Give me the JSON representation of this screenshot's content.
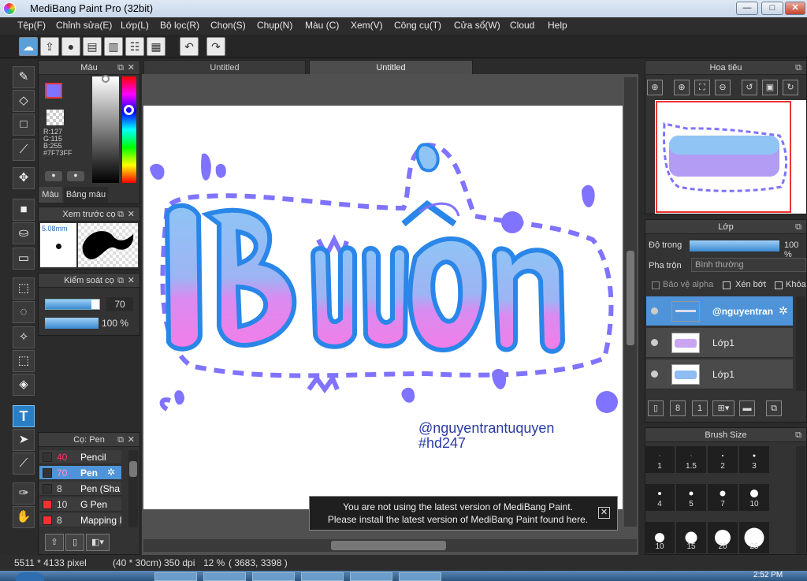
{
  "window": {
    "title": "MediBang Paint Pro (32bit)",
    "min": "—",
    "max": "□",
    "close": "✕"
  },
  "menu": [
    "Tệp(F)",
    "Chỉnh sửa(E)",
    "Lớp(L)",
    "Bộ lọc(R)",
    "Chọn(S)",
    "Chụp(N)",
    "Màu (C)",
    "Xem(V)",
    "Công cụ(T)",
    "Cửa sổ(W)",
    "Cloud",
    "Help"
  ],
  "toolbar": {
    "undo": "↶",
    "redo": "↷"
  },
  "tabs": [
    "Untitled",
    "Untitled"
  ],
  "color_panel": {
    "title": "Màu",
    "r": "R:127",
    "g": "G:115",
    "b": "B:255",
    "hex": "#7F73FF",
    "tab_color": "Màu",
    "tab_palette": "Bảng màu",
    "primary": "#7f73ff",
    "secondary": "#1a1aa0"
  },
  "preview_panel": {
    "title": "Xem trước cọ",
    "size": "5.08mm"
  },
  "control_panel": {
    "title": "Kiểm soát cọ",
    "size": "70",
    "opacity": "100 %"
  },
  "brush_panel": {
    "title": "Cọ: Pen",
    "items": [
      {
        "size": "40",
        "name": "Pencil",
        "color": "#333333"
      },
      {
        "size": "70",
        "name": "Pen",
        "color": "#333333"
      },
      {
        "size": "8",
        "name": "Pen (Sha",
        "color": "#333333"
      },
      {
        "size": "10",
        "name": "G Pen",
        "color": "#e33333"
      },
      {
        "size": "8",
        "name": "Mapping I",
        "color": "#e33333"
      }
    ]
  },
  "canvas": {
    "artwork_text": "Buồn",
    "handle": "@nguyentrantuquyen",
    "hashtag": "#hd247"
  },
  "notice": {
    "line1": "You are not using the latest version of MediBang Paint.",
    "line2": "Please install the latest version of MediBang Paint found here.",
    "close": "✕"
  },
  "status": {
    "size": "5511 * 4133 pixel",
    "dims": "(40 * 30cm)",
    "dpi": "350 dpi",
    "zoom": "12 %",
    "coords": "( 3683, 3398 )"
  },
  "navigator": {
    "title": "Hoa tiêu"
  },
  "layer_panel": {
    "title": "Lớp",
    "opacity_label": "Độ trong",
    "opacity_value": "100 %",
    "blend_label": "Pha trộn",
    "blend_value": "Bình thường",
    "protect_alpha": "Bảo vệ alpha",
    "clipping": "Xén bớt",
    "lock": "Khóa",
    "layers": [
      "@nguyentran",
      "Lớp1",
      "Lớp1"
    ]
  },
  "brush_size_panel": {
    "title": "Brush Size",
    "sizes": [
      "1",
      "1.5",
      "2",
      "3",
      "4",
      "5",
      "7",
      "10",
      "10",
      "15",
      "20",
      "25"
    ]
  },
  "clock": "2:52 PM"
}
